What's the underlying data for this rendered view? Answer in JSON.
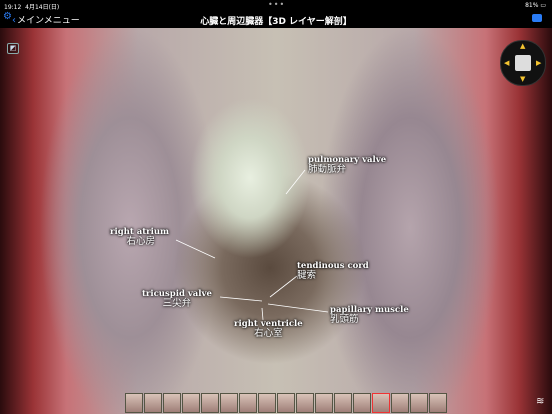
{
  "status": {
    "time": "19:12",
    "date": "4月14日(日)",
    "battery": "81%"
  },
  "nav": {
    "back_label": "メインメニュー",
    "title": "心臓と周辺臓器【3D レイヤー解剖】"
  },
  "labels": [
    {
      "en": "pulmonary valve",
      "jp": "肺動脈弁"
    },
    {
      "en": "right atrium",
      "jp": "右心房"
    },
    {
      "en": "tendinous cord",
      "jp": "腱索"
    },
    {
      "en": "tricuspid valve",
      "jp": "三尖弁"
    },
    {
      "en": "papillary muscle",
      "jp": "乳頭筋"
    },
    {
      "en": "right ventricle",
      "jp": "右心室"
    }
  ],
  "thumbnails": {
    "count": 17,
    "active_index": 13
  }
}
